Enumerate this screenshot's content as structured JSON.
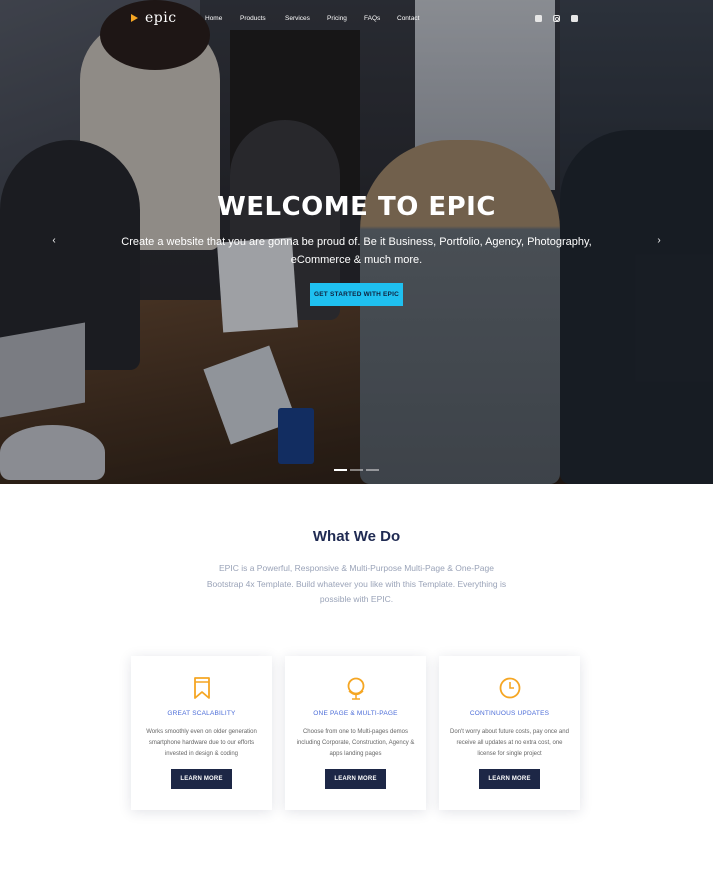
{
  "brand": {
    "name": "epic",
    "accent": "#f5a623"
  },
  "nav": {
    "items": [
      {
        "label": "Home"
      },
      {
        "label": "Products"
      },
      {
        "label": "Services"
      },
      {
        "label": "Pricing"
      },
      {
        "label": "FAQs"
      },
      {
        "label": "Contact"
      }
    ],
    "social": [
      "facebook-icon",
      "instagram-icon",
      "twitter-icon"
    ]
  },
  "hero": {
    "title": "WELCOME TO EPIC",
    "subtitle": "Create a website that you are gonna be proud of. Be it Business, Portfolio, Agency, Photography, eCommerce & much more.",
    "cta_label": "GET STARTED WITH EPIC",
    "cta_color": "#1fc0f0",
    "prev_glyph": "‹",
    "next_glyph": "›",
    "slides": 3,
    "active_slide": 1
  },
  "what_we_do": {
    "title": "What We Do",
    "text": "EPIC is a Powerful, Responsive & Multi-Purpose Multi-Page & One-Page Bootstrap 4x Template. Build whatever you like with this Template. Everything is possible with EPIC."
  },
  "features": [
    {
      "icon": "bookmark-icon",
      "title": "GREAT SCALABILITY",
      "desc": "Works smoothly even on older generation smartphone hardware due to our efforts invested in design & coding",
      "button": "LEARN MORE"
    },
    {
      "icon": "globe-icon",
      "title": "ONE PAGE & MULTI-PAGE",
      "desc": "Choose from one to Multi-pages demos including Corporate, Construction, Agency & apps landing pages",
      "button": "LEARN MORE"
    },
    {
      "icon": "clock-icon",
      "title": "CONTINUOUS UPDATES",
      "desc": "Don't worry about future costs, pay once and receive all updates at no extra cost, one license for single project",
      "button": "LEARN MORE"
    }
  ]
}
